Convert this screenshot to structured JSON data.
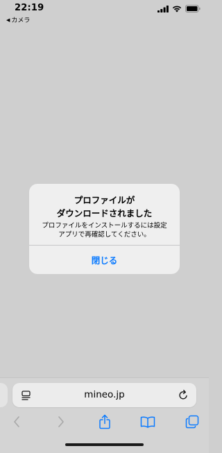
{
  "status_bar": {
    "time": "22:19",
    "back_app_arrow": "◀",
    "back_app_label": "カメラ",
    "icons": [
      "cellular-signal-icon",
      "wifi-icon",
      "battery-icon"
    ]
  },
  "alert": {
    "title": "プロファイルが\nダウンロードされました",
    "message": "プロファイルをインストールするには設定\nアプリで再確認してください。",
    "close_button_label": "閉じる"
  },
  "browser": {
    "url": "mineo.jp",
    "page_menu_icon": "page-menu-icon",
    "reload_icon": "reload-icon",
    "toolbar_icons": [
      "back-arrow-icon",
      "forward-arrow-icon",
      "share-icon",
      "bookmarks-icon",
      "tabs-icon"
    ]
  },
  "colors": {
    "accent": "#0a7aff",
    "background": "#cfcfcf",
    "alert_background": "#efefef",
    "disabled_icon": "#a9a9a9"
  }
}
